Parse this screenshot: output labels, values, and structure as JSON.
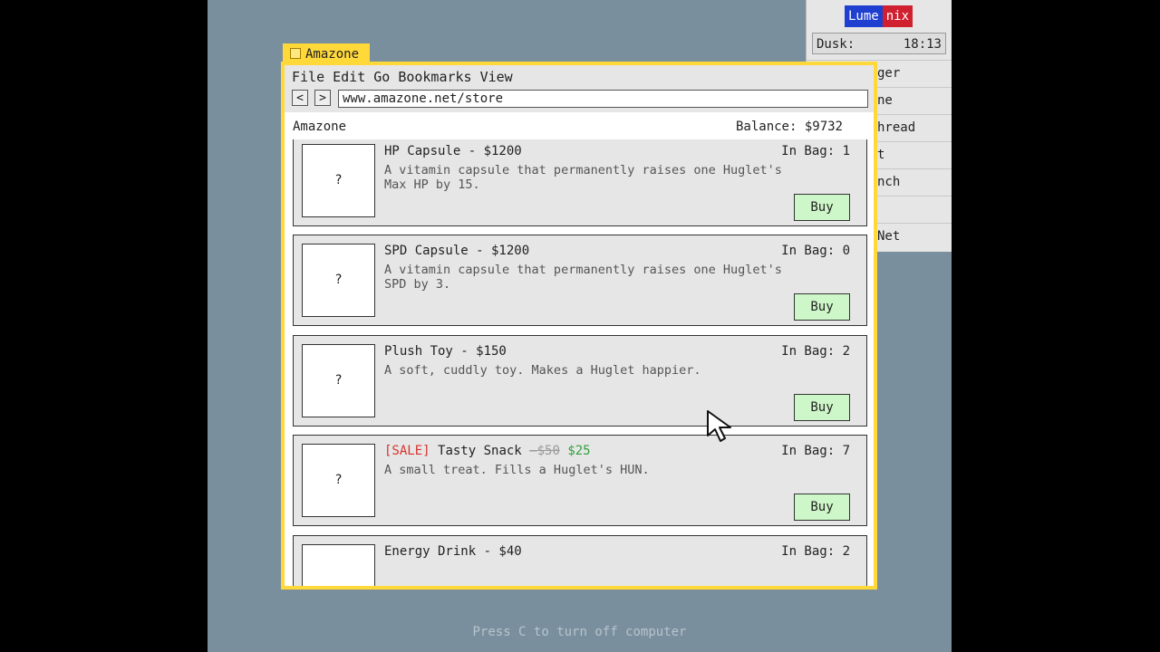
{
  "os": {
    "logo_part1": "Lume",
    "logo_part2": "nix",
    "time_of_day": "Dusk:",
    "clock": "18:13",
    "menu_items": [
      "ger",
      "ne",
      "hread",
      "t",
      "nch",
      "",
      "Net"
    ],
    "hint": "Press C to turn off computer"
  },
  "browser": {
    "tab_title": "Amazone",
    "menu": [
      "File",
      "Edit",
      "Go",
      "Bookmarks",
      "View"
    ],
    "back_glyph": "<",
    "forward_glyph": ">",
    "url": "www.amazone.net/store"
  },
  "store": {
    "name": "Amazone",
    "balance": "Balance: $9732",
    "buy_label": "Buy",
    "thumb_placeholder": "?",
    "items": [
      {
        "title": "HP Capsule - $1200",
        "desc": "A vitamin capsule that permanently raises one Huglet's Max HP by 15.",
        "in_bag": "In Bag: 1"
      },
      {
        "title": "SPD Capsule - $1200",
        "desc": "A vitamin capsule that permanently raises one Huglet's SPD by 3.",
        "in_bag": "In Bag: 0"
      },
      {
        "title": "Plush Toy - $150",
        "desc": "A soft, cuddly toy. Makes a Huglet happier.",
        "in_bag": "In Bag: 2"
      },
      {
        "sale_tag": "[SALE]",
        "name": "Tasty Snack",
        "old_price": "—$50",
        "new_price": "$25",
        "desc": "A small treat. Fills a Huglet's HUN.",
        "in_bag": "In Bag: 7"
      },
      {
        "title": "Energy Drink - $40",
        "in_bag": "In Bag: 2"
      }
    ]
  },
  "colors": {
    "window_frame": "#ffd83a",
    "buy_button": "#cdf7c8",
    "sale": "#d8322d",
    "sale_price": "#2fa13c",
    "desktop": "#7a8f9d"
  }
}
